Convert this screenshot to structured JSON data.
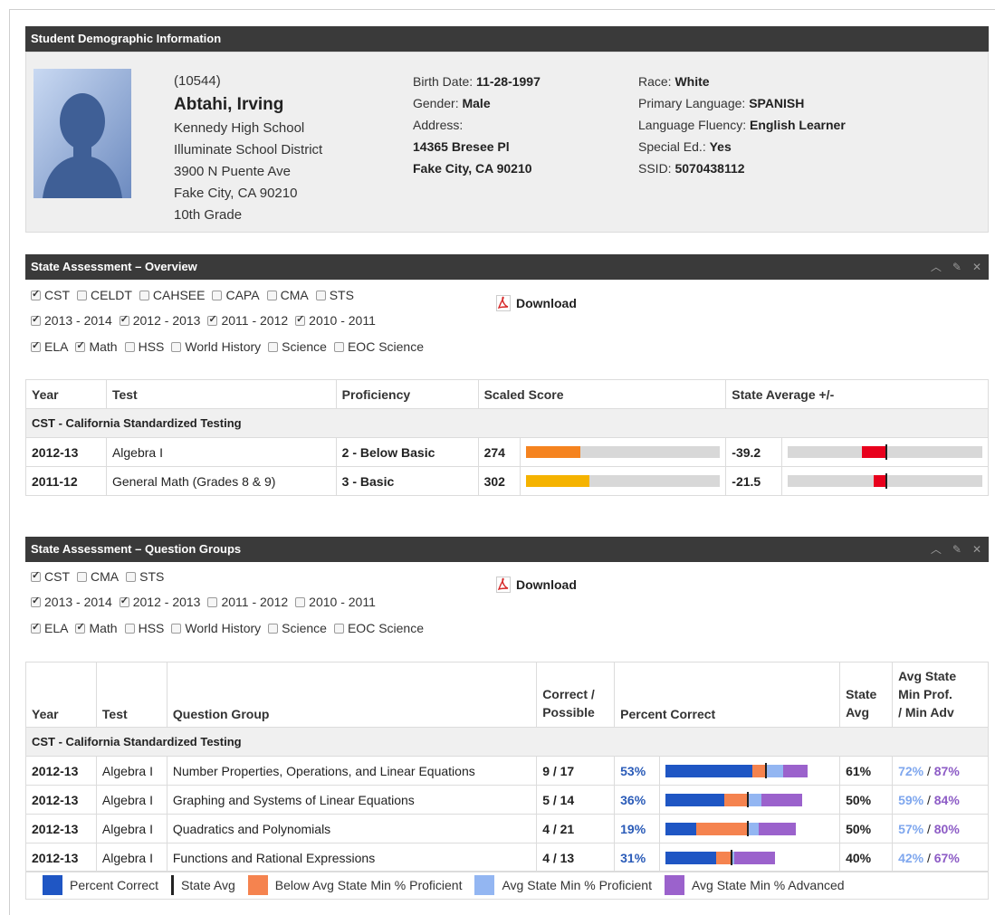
{
  "demographics": {
    "header": "Student Demographic Information",
    "student_id": "(10544)",
    "name": "Abtahi, Irving",
    "school": "Kennedy High School",
    "district": "Illuminate School District",
    "street": "3900 N Puente Ave",
    "city": "Fake City, CA 90210",
    "grade": "10th Grade",
    "birth_label": "Birth Date:",
    "birth_value": "11-28-1997",
    "gender_label": "Gender:",
    "gender_value": "Male",
    "address_label": "Address:",
    "address_line1": "14365 Bresee Pl",
    "address_line2": "Fake City, CA 90210",
    "race_label": "Race:",
    "race_value": "White",
    "lang_label": "Primary Language:",
    "lang_value": "SPANISH",
    "fluency_label": "Language Fluency:",
    "fluency_value": "English Learner",
    "sped_label": "Special Ed.:",
    "sped_value": "Yes",
    "ssid_label": "SSID:",
    "ssid_value": "5070438112"
  },
  "overview": {
    "header": "State Assessment – Overview",
    "download": "Download",
    "tests": [
      {
        "label": "CST",
        "checked": true
      },
      {
        "label": "CELDT",
        "checked": false
      },
      {
        "label": "CAHSEE",
        "checked": false
      },
      {
        "label": "CAPA",
        "checked": false
      },
      {
        "label": "CMA",
        "checked": false
      },
      {
        "label": "STS",
        "checked": false
      }
    ],
    "years": [
      {
        "label": "2013 - 2014",
        "checked": true
      },
      {
        "label": "2012 - 2013",
        "checked": true
      },
      {
        "label": "2011 - 2012",
        "checked": true
      },
      {
        "label": "2010 - 2011",
        "checked": true
      }
    ],
    "subjects": [
      {
        "label": "ELA",
        "checked": true
      },
      {
        "label": "Math",
        "checked": true
      },
      {
        "label": "HSS",
        "checked": false
      },
      {
        "label": "World History",
        "checked": false
      },
      {
        "label": "Science",
        "checked": false
      },
      {
        "label": "EOC Science",
        "checked": false
      }
    ],
    "columns": [
      "Year",
      "Test",
      "Proficiency",
      "Scaled Score",
      "State Average +/-"
    ],
    "group": "CST - California Standardized Testing",
    "rows": [
      {
        "year": "2012-13",
        "test": "Algebra I",
        "proficiency": "2 - Below Basic",
        "score": "274",
        "score_fraction": 0.28,
        "score_color": "#f5831f",
        "diff": "-39.2",
        "diff_mark_start": 0.38,
        "diff_mark_width": 0.12
      },
      {
        "year": "2011-12",
        "test": "General Math (Grades 8 & 9)",
        "proficiency": "3 - Basic",
        "score": "302",
        "score_fraction": 0.33,
        "score_color": "#f5b300",
        "diff": "-21.5",
        "diff_mark_start": 0.44,
        "diff_mark_width": 0.06
      }
    ]
  },
  "groups": {
    "header": "State Assessment – Question Groups",
    "download": "Download",
    "tests": [
      {
        "label": "CST",
        "checked": true
      },
      {
        "label": "CMA",
        "checked": false
      },
      {
        "label": "STS",
        "checked": false
      }
    ],
    "years": [
      {
        "label": "2013 - 2014",
        "checked": true
      },
      {
        "label": "2012 - 2013",
        "checked": true
      },
      {
        "label": "2011 - 2012",
        "checked": false
      },
      {
        "label": "2010 - 2011",
        "checked": false
      }
    ],
    "subjects": [
      {
        "label": "ELA",
        "checked": true
      },
      {
        "label": "Math",
        "checked": true
      },
      {
        "label": "HSS",
        "checked": false
      },
      {
        "label": "World History",
        "checked": false
      },
      {
        "label": "Science",
        "checked": false
      },
      {
        "label": "EOC Science",
        "checked": false
      }
    ],
    "col_year": "Year",
    "col_test": "Test",
    "col_group": "Question Group",
    "col_correct_1": "Correct /",
    "col_correct_2": "Possible",
    "col_percent": "Percent Correct",
    "col_state_1": "State",
    "col_state_2": "Avg",
    "col_minprof_1": "Avg State",
    "col_minprof_2": "Min Prof.",
    "col_minprof_3": "/ Min Adv",
    "group": "CST - California Standardized Testing",
    "rows": [
      {
        "year": "2012-13",
        "test": "Algebra I",
        "group": "Number Properties, Operations, and Linear Equations",
        "correct": "9 / 17",
        "pct": "53%",
        "pct_v": 0.53,
        "state": "61%",
        "state_v": 0.61,
        "prof": "72%",
        "prof_v": 0.72,
        "adv": "87%",
        "adv_v": 0.87
      },
      {
        "year": "2012-13",
        "test": "Algebra I",
        "group": "Graphing and Systems of Linear Equations",
        "correct": "5 / 14",
        "pct": "36%",
        "pct_v": 0.36,
        "state": "50%",
        "state_v": 0.5,
        "prof": "59%",
        "prof_v": 0.59,
        "adv": "84%",
        "adv_v": 0.84
      },
      {
        "year": "2012-13",
        "test": "Algebra I",
        "group": "Quadratics and Polynomials",
        "correct": "4 / 21",
        "pct": "19%",
        "pct_v": 0.19,
        "state": "50%",
        "state_v": 0.5,
        "prof": "57%",
        "prof_v": 0.57,
        "adv": "80%",
        "adv_v": 0.8
      },
      {
        "year": "2012-13",
        "test": "Algebra I",
        "group": "Functions and Rational Expressions",
        "correct": "4 / 13",
        "pct": "31%",
        "pct_v": 0.31,
        "state": "40%",
        "state_v": 0.4,
        "prof": "42%",
        "prof_v": 0.42,
        "adv": "67%",
        "adv_v": 0.67
      }
    ],
    "slash": "/",
    "legend": {
      "percent": "Percent Correct",
      "state": "State Avg",
      "below": "Below Avg State Min % Proficient",
      "prof": "Avg State Min % Proficient",
      "adv": "Avg State Min % Advanced"
    }
  },
  "colors": {
    "percent": "#1f56c4",
    "below": "#f5834f",
    "prof": "#93b6f2",
    "adv": "#9b62cc",
    "header": "#3a3a3a"
  }
}
